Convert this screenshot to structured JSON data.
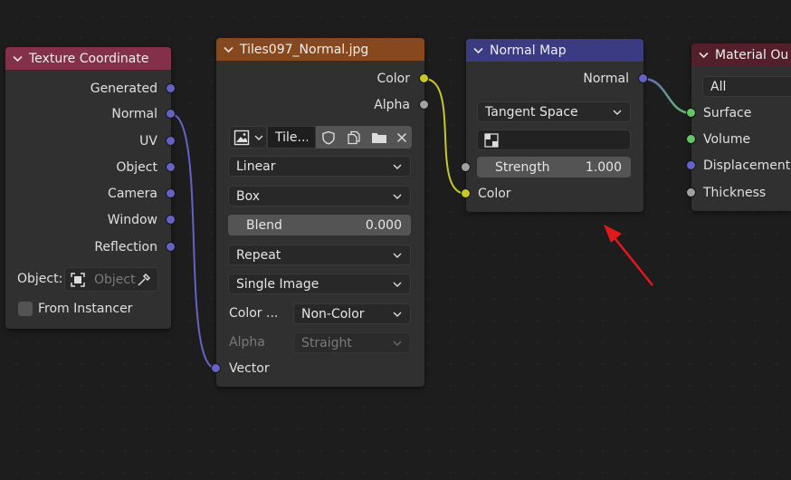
{
  "colors": {
    "background": "#1d1d1d",
    "node_body": "#303030",
    "texcoord_header": "#83314a",
    "image_header": "#87481e",
    "normalmap_header": "#3b3b83",
    "output_header": "#521f2a",
    "vector_socket": "#6363c7",
    "color_socket": "#c7c729",
    "float_socket": "#a1a1a1",
    "shader_socket": "#63c763",
    "annotation_arrow": "#e01a1a"
  },
  "texture_coordinate": {
    "title": "Texture Coordinate",
    "outputs": [
      "Generated",
      "Normal",
      "UV",
      "Object",
      "Camera",
      "Window",
      "Reflection"
    ],
    "object_label": "Object:",
    "object_placeholder": "Object",
    "from_instancer": "From Instancer"
  },
  "image_texture": {
    "title": "Tiles097_Normal.jpg",
    "outputs": {
      "color": "Color",
      "alpha": "Alpha"
    },
    "image_name": "Tile...",
    "interpolation": "Linear",
    "projection": "Box",
    "blend_label": "Blend",
    "blend_value": "0.000",
    "extension": "Repeat",
    "source": "Single Image",
    "color_space_label": "Color ...",
    "color_space_value": "Non-Color",
    "alpha_label": "Alpha",
    "alpha_value": "Straight",
    "input_vector": "Vector"
  },
  "normal_map": {
    "title": "Normal Map",
    "output_normal": "Normal",
    "space": "Tangent Space",
    "strength_label": "Strength",
    "strength_value": "1.000",
    "input_color": "Color"
  },
  "material_output": {
    "title": "Material Ou",
    "target": "All",
    "inputs": [
      "Surface",
      "Volume",
      "Displacement",
      "Thickness"
    ]
  }
}
